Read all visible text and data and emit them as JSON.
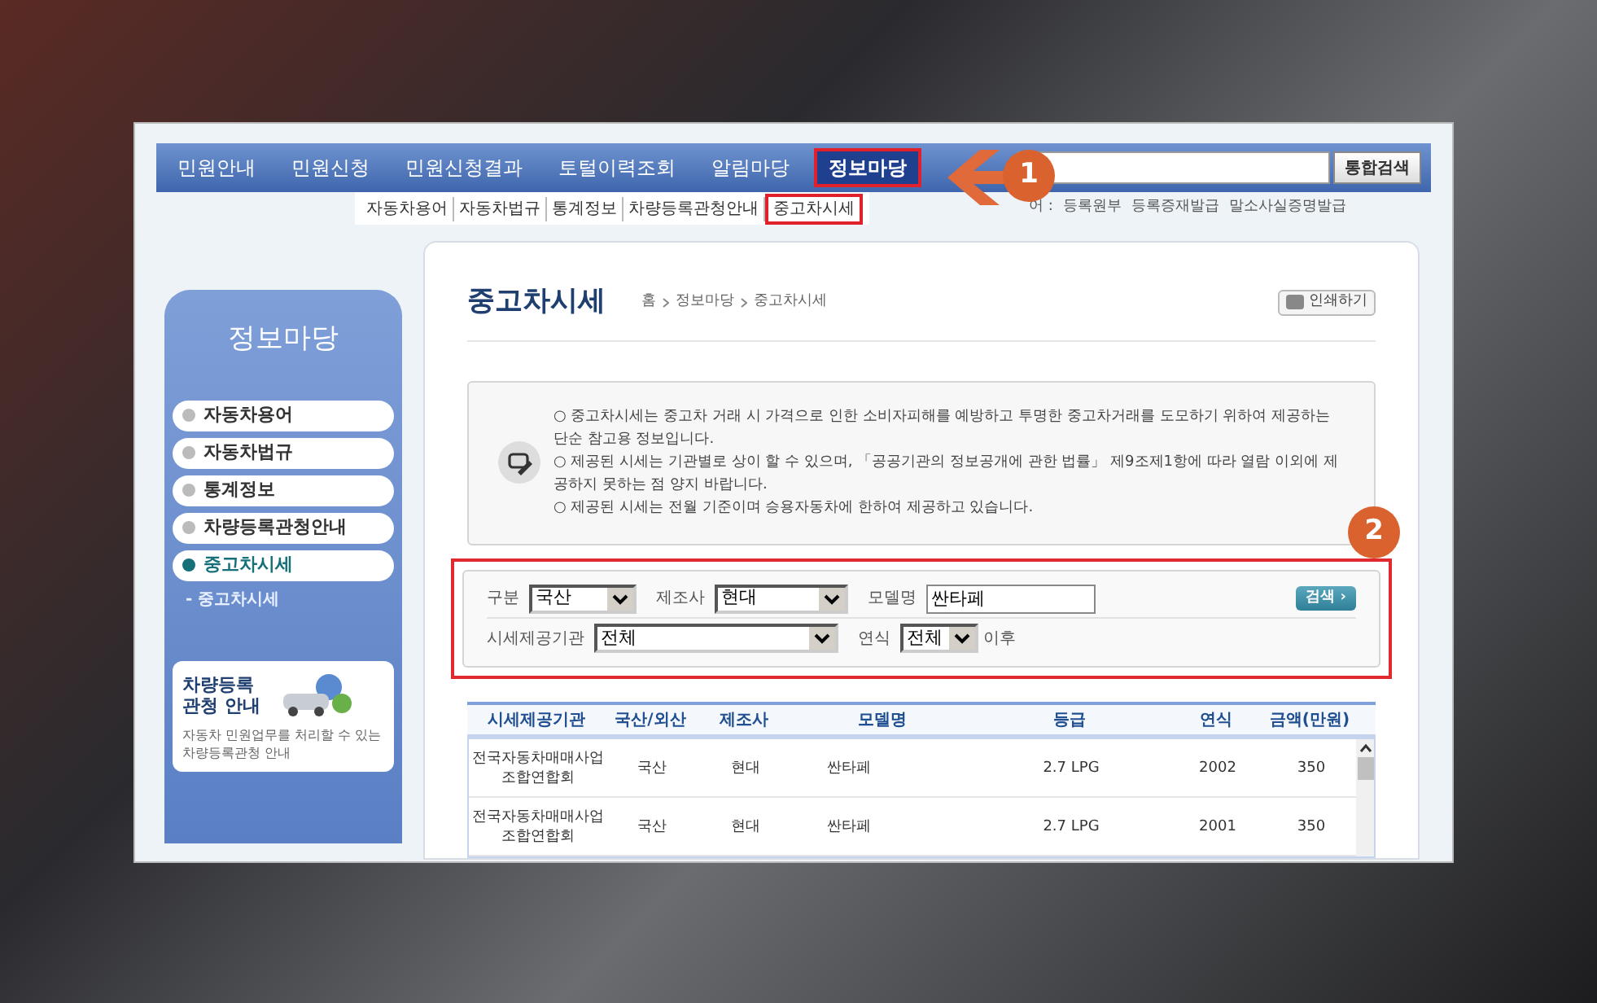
{
  "nav": {
    "items": [
      {
        "label": "민원안내",
        "selected": false
      },
      {
        "label": "민원신청",
        "selected": false
      },
      {
        "label": "민원신청결과",
        "selected": false
      },
      {
        "label": "토털이력조회",
        "selected": false
      },
      {
        "label": "알림마당",
        "selected": false
      },
      {
        "label": "정보마당",
        "selected": true
      }
    ],
    "search_button": "통합검색"
  },
  "submenu": [
    {
      "label": "자동차용어",
      "selected": false
    },
    {
      "label": "자동차법규",
      "selected": false
    },
    {
      "label": "통계정보",
      "selected": false
    },
    {
      "label": "차량등록관청안내",
      "selected": false
    },
    {
      "label": "중고차시세",
      "selected": true
    }
  ],
  "quick_links": {
    "label": "어 :",
    "links": [
      "등록원부",
      "등록증재발급",
      "말소사실증명발급"
    ]
  },
  "sidebar": {
    "title": "정보마당",
    "items": [
      {
        "label": "자동차용어",
        "selected": false
      },
      {
        "label": "자동차법규",
        "selected": false
      },
      {
        "label": "통계정보",
        "selected": false
      },
      {
        "label": "차량등록관청안내",
        "selected": false
      },
      {
        "label": "중고차시세",
        "selected": true
      }
    ],
    "sub_items": [
      "- 중고차시세"
    ],
    "promo": {
      "title_lines": [
        "차량등록",
        "관청 안내"
      ],
      "text": "자동차 민원업무를 처리할 수 있는 차량등록관청 안내"
    }
  },
  "content": {
    "title": "중고차시세",
    "breadcrumb": [
      "홈",
      "정보마당",
      "중고차시세"
    ],
    "print_button": "인쇄하기"
  },
  "notice": [
    "○ 중고차시세는 중고차 거래 시 가격으로 인한 소비자피해를 예방하고 투명한 중고차거래를 도모하기 위하여 제공하는 단순 참고용 정보입니다.",
    "○ 제공된 시세는 기관별로 상이 할 수 있으며, 「공공기관의 정보공개에 관한 법률」 제9조제1항에 따라 열람 이외에 제공하지 못하는 점 양지 바랍니다.",
    "○ 제공된 시세는 전월 기준이며 승용자동차에 한하여 제공하고 있습니다."
  ],
  "form": {
    "row1": [
      {
        "label": "구분",
        "value": "국산",
        "kind": "select"
      },
      {
        "label": "제조사",
        "value": "현대",
        "kind": "select"
      },
      {
        "label": "모델명",
        "value": "싼타페",
        "kind": "text"
      }
    ],
    "row2": [
      {
        "label": "시세제공기관",
        "value": "전체",
        "kind": "select"
      },
      {
        "label": "연식",
        "value": "전체",
        "kind": "select",
        "suffix": "이후"
      }
    ],
    "search_button": "검색 ›"
  },
  "table": {
    "columns": [
      "시세제공기관",
      "국산/외산",
      "제조사",
      "모델명",
      "등급",
      "연식",
      "금액(만원)"
    ],
    "rows": [
      [
        "전국자동차매매사업조합연합회",
        "국산",
        "현대",
        "싼타페",
        "2.7 LPG",
        "2002",
        "350"
      ],
      [
        "전국자동차매매사업조합연합회",
        "국산",
        "현대",
        "싼타페",
        "2.7 LPG",
        "2001",
        "350"
      ]
    ]
  },
  "annotations": [
    "1",
    "2"
  ]
}
